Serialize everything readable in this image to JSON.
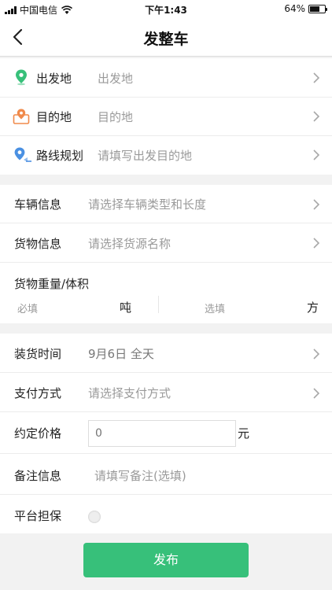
{
  "status_bar": {
    "carrier": "中国电信",
    "time": "下午1:43",
    "battery": "64%",
    "battery_level": 0.64
  },
  "header": {
    "title": "发整车"
  },
  "route": {
    "origin": {
      "label": "出发地",
      "placeholder": "出发地"
    },
    "destination": {
      "label": "目的地",
      "placeholder": "目的地"
    },
    "plan": {
      "label": "路线规划",
      "placeholder": "请填写出发目的地"
    }
  },
  "goods": {
    "vehicle": {
      "label": "车辆信息",
      "placeholder": "请选择车辆类型和长度"
    },
    "cargo": {
      "label": "货物信息",
      "placeholder": "请选择货源名称"
    },
    "weight": {
      "label": "货物重量/体积",
      "required": "必填",
      "unit_weight": "吨",
      "optional": "选填",
      "unit_volume": "方"
    }
  },
  "details": {
    "loading_time": {
      "label": "装货时间",
      "value": "9月6日 全天"
    },
    "payment": {
      "label": "支付方式",
      "placeholder": "请选择支付方式"
    },
    "price": {
      "label": "约定价格",
      "placeholder": "0",
      "unit": "元"
    },
    "remark": {
      "label": "备注信息",
      "placeholder": "请填写备注(选填)"
    },
    "guarantee": {
      "label": "平台担保"
    }
  },
  "footer": {
    "publish_label": "发布"
  },
  "colors": {
    "accent": "#37c07a",
    "origin_pin": "#37c07a",
    "destination_pin": "#f08a4b",
    "route_icon": "#4a90e2"
  }
}
